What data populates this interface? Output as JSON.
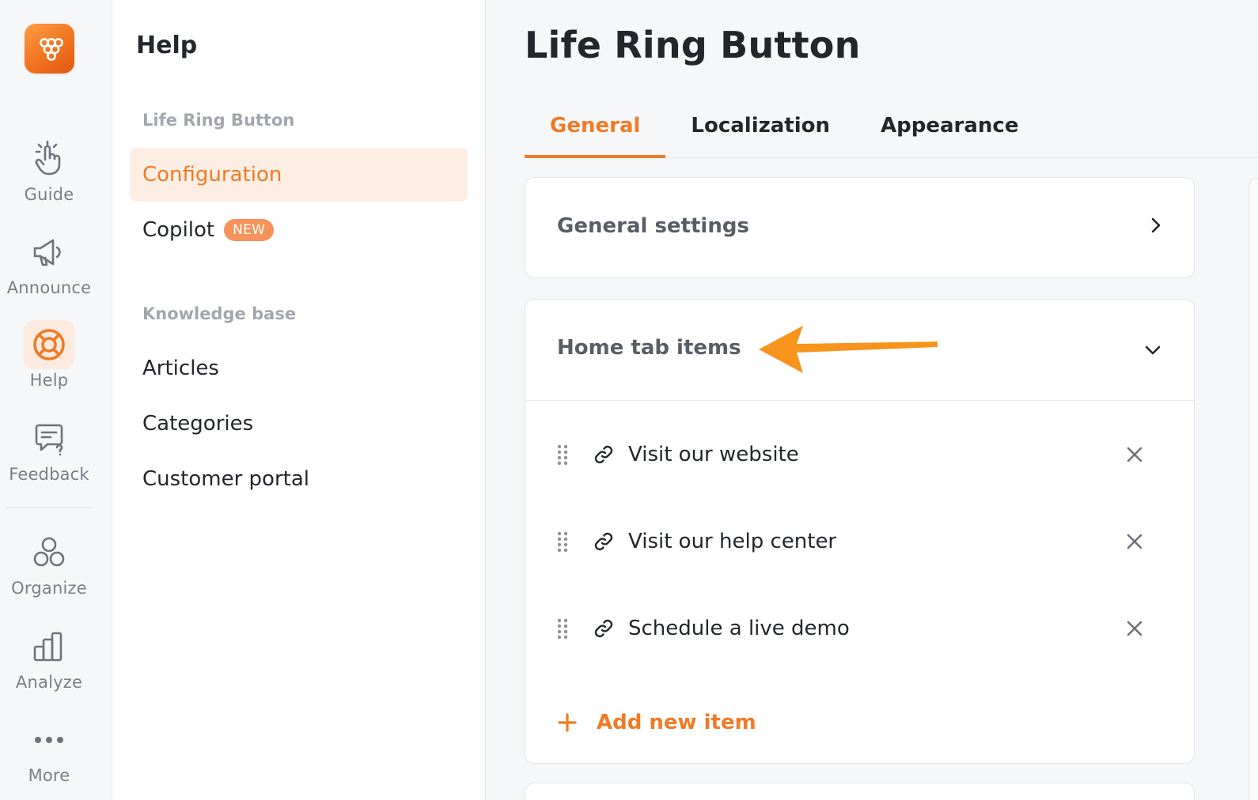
{
  "rail": {
    "items": [
      {
        "label": "Guide",
        "icon": "hand-pointer-icon"
      },
      {
        "label": "Announce",
        "icon": "megaphone-icon"
      },
      {
        "label": "Help",
        "icon": "life-ring-icon",
        "active": true
      },
      {
        "label": "Feedback",
        "icon": "feedback-bubble-icon"
      },
      {
        "label": "Organize",
        "icon": "organize-circles-icon"
      },
      {
        "label": "Analyze",
        "icon": "bar-chart-icon"
      },
      {
        "label": "More",
        "icon": "more-dots-icon"
      }
    ]
  },
  "sidebar": {
    "title": "Help",
    "section1": "Life Ring Button",
    "items1": [
      {
        "label": "Configuration",
        "active": true
      },
      {
        "label": "Copilot",
        "badge": "NEW"
      }
    ],
    "section2": "Knowledge base",
    "items2": [
      {
        "label": "Articles"
      },
      {
        "label": "Categories"
      },
      {
        "label": "Customer portal"
      }
    ]
  },
  "main": {
    "title": "Life Ring Button",
    "tabs": [
      {
        "label": "General",
        "active": true
      },
      {
        "label": "Localization"
      },
      {
        "label": "Appearance"
      }
    ],
    "general_settings": {
      "title": "General settings"
    },
    "home_tab": {
      "title": "Home tab items",
      "items": [
        {
          "label": "Visit our website"
        },
        {
          "label": "Visit our help center"
        },
        {
          "label": "Schedule a live demo"
        }
      ],
      "add_label": "Add new item"
    }
  },
  "colors": {
    "accent": "#f07b26",
    "active_bg": "#fdeee4",
    "annotation_arrow": "#f7941d"
  }
}
